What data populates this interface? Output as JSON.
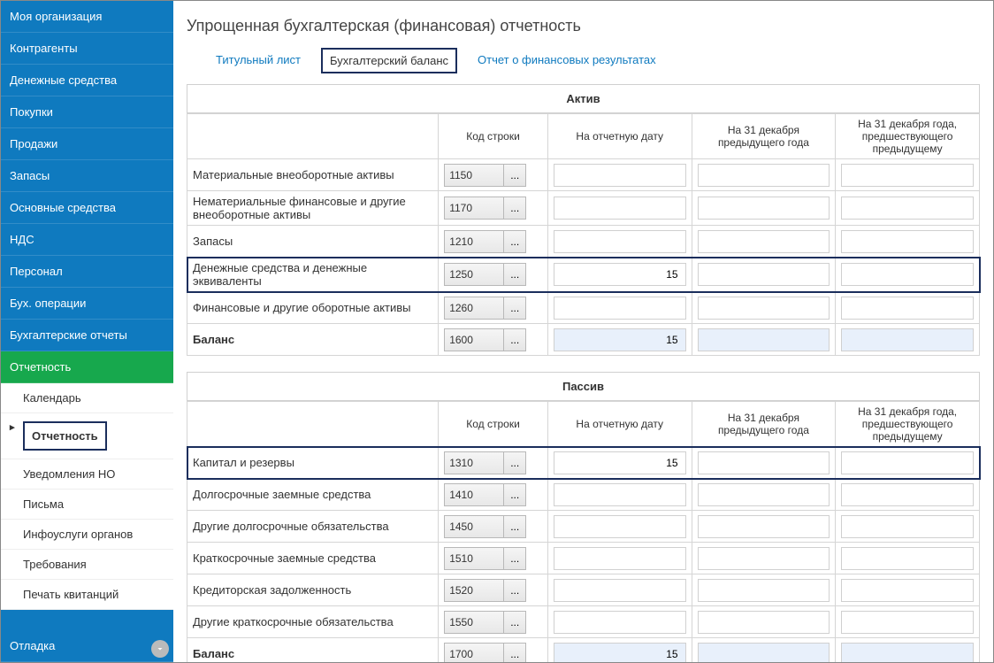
{
  "sidebar": {
    "items": [
      {
        "label": "Моя организация"
      },
      {
        "label": "Контрагенты"
      },
      {
        "label": "Денежные средства"
      },
      {
        "label": "Покупки"
      },
      {
        "label": "Продажи"
      },
      {
        "label": "Запасы"
      },
      {
        "label": "Основные средства"
      },
      {
        "label": "НДС"
      },
      {
        "label": "Персонал"
      },
      {
        "label": "Бух. операции"
      },
      {
        "label": "Бухгалтерские отчеты"
      },
      {
        "label": "Отчетность",
        "active": true
      }
    ],
    "submenu": [
      {
        "label": "Календарь"
      },
      {
        "label": "Отчетность",
        "selected": true
      },
      {
        "label": "Уведомления НО"
      },
      {
        "label": "Письма"
      },
      {
        "label": "Инфоуслуги органов"
      },
      {
        "label": "Требования"
      },
      {
        "label": "Печать квитанций"
      }
    ],
    "bottom": [
      {
        "label": "Отладка"
      }
    ]
  },
  "page": {
    "title": "Упрощенная бухгалтерская (финансовая) отчетность"
  },
  "tabs": [
    {
      "label": "Титульный лист"
    },
    {
      "label": "Бухгалтерский баланс",
      "active": true
    },
    {
      "label": "Отчет о финансовых результатах"
    }
  ],
  "sections": {
    "assets": {
      "title": "Актив",
      "columns": {
        "label": "",
        "code": "Код строки",
        "current": "На отчетную дату",
        "prev": "На 31 декабря предыдущего года",
        "prev2": "На 31 декабря года, предшествующего предыдущему"
      },
      "rows": [
        {
          "label": "Материальные внеоборотные активы",
          "code": "1150",
          "current": "",
          "prev": "",
          "prev2": ""
        },
        {
          "label": "Нематериальные финансовые и другие внеоборотные активы",
          "code": "1170",
          "current": "",
          "prev": "",
          "prev2": ""
        },
        {
          "label": "Запасы",
          "code": "1210",
          "current": "",
          "prev": "",
          "prev2": ""
        },
        {
          "label": "Денежные средства и денежные эквиваленты",
          "code": "1250",
          "current": "15",
          "prev": "",
          "prev2": "",
          "highlighted": true
        },
        {
          "label": "Финансовые и другие оборотные активы",
          "code": "1260",
          "current": "",
          "prev": "",
          "prev2": ""
        },
        {
          "label": "Баланс",
          "code": "1600",
          "current": "15",
          "prev": "",
          "prev2": "",
          "bold": true,
          "readonly": true
        }
      ]
    },
    "liabilities": {
      "title": "Пассив",
      "columns": {
        "label": "",
        "code": "Код строки",
        "current": "На отчетную дату",
        "prev": "На 31 декабря предыдущего года",
        "prev2": "На 31 декабря года, предшествующего предыдущему"
      },
      "rows": [
        {
          "label": "Капитал и резервы",
          "code": "1310",
          "current": "15",
          "prev": "",
          "prev2": "",
          "highlighted": true
        },
        {
          "label": "Долгосрочные заемные средства",
          "code": "1410",
          "current": "",
          "prev": "",
          "prev2": ""
        },
        {
          "label": "Другие долгосрочные обязательства",
          "code": "1450",
          "current": "",
          "prev": "",
          "prev2": ""
        },
        {
          "label": "Краткосрочные заемные средства",
          "code": "1510",
          "current": "",
          "prev": "",
          "prev2": ""
        },
        {
          "label": "Кредиторская задолженность",
          "code": "1520",
          "current": "",
          "prev": "",
          "prev2": ""
        },
        {
          "label": "Другие краткосрочные обязательства",
          "code": "1550",
          "current": "",
          "prev": "",
          "prev2": ""
        },
        {
          "label": "Баланс",
          "code": "1700",
          "current": "15",
          "prev": "",
          "prev2": "",
          "bold": true,
          "readonly": true
        }
      ]
    }
  },
  "ellipsis": "..."
}
